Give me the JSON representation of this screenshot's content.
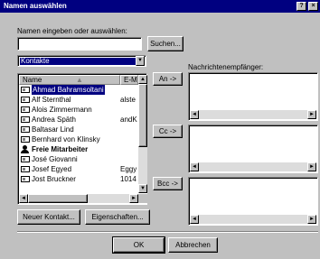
{
  "window": {
    "title": "Namen auswählen",
    "help_label": "?",
    "close_label": "×"
  },
  "search": {
    "label": "Namen eingeben oder auswählen:",
    "value": "",
    "button": "Suchen..."
  },
  "address_book": {
    "selected": "Kontakte",
    "dropdown_arrow": "▼"
  },
  "contacts_list": {
    "columns": [
      "Name",
      "E-Ma"
    ],
    "sort_arrow": "▲",
    "rows": [
      {
        "name": "Ahmad Bahramsoltani",
        "email": "",
        "icon": "contact-card-icon"
      },
      {
        "name": "Alf Sternthal",
        "email": "alste",
        "icon": "contact-card-icon"
      },
      {
        "name": "Alois Zimmermann",
        "email": "",
        "icon": "contact-card-icon"
      },
      {
        "name": "Andrea Späth",
        "email": "andK",
        "icon": "contact-card-icon"
      },
      {
        "name": "Baltasar Lind",
        "email": "",
        "icon": "contact-card-icon"
      },
      {
        "name": "Bernhard von Klinsky",
        "email": "",
        "icon": "contact-card-icon"
      },
      {
        "name": "Freie Mitarbeiter",
        "email": "",
        "icon": "group-icon"
      },
      {
        "name": "José Giovanni",
        "email": "",
        "icon": "contact-card-icon"
      },
      {
        "name": "Josef Egyed",
        "email": "Eggy",
        "icon": "contact-card-icon"
      },
      {
        "name": "Jost Bruckner",
        "email": "1014",
        "icon": "contact-card-icon"
      }
    ],
    "selected_index": 0,
    "bold_index": 6
  },
  "buttons": {
    "to": "An ->",
    "cc": "Cc ->",
    "bcc": "Bcc ->",
    "new_contact": "Neuer Kontakt...",
    "properties": "Eigenschaften...",
    "ok": "OK",
    "cancel": "Abbrechen"
  },
  "recipients": {
    "label": "Nachrichtenempfänger:"
  },
  "scroll_glyphs": {
    "up": "▲",
    "down": "▼",
    "left": "◄",
    "right": "►"
  }
}
